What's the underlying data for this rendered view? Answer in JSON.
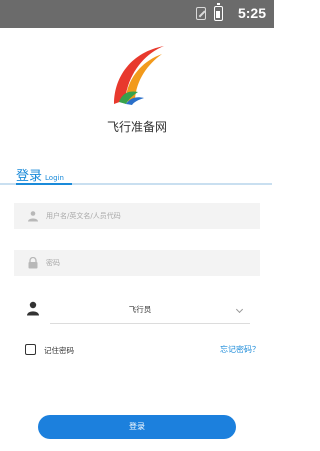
{
  "status_bar": {
    "time": "5:25"
  },
  "app": {
    "name": "飞行准备网"
  },
  "tab": {
    "label": "登录",
    "label_en": "Login"
  },
  "form": {
    "username_placeholder": "用户名/英文名/人员代码",
    "password_placeholder": "密码",
    "role_value": "飞行员",
    "remember_label": "记住密码",
    "forgot_label": "忘记密码？",
    "submit_label": "登录"
  },
  "colors": {
    "accent": "#1a8ad9",
    "button": "#1c80dd",
    "status_bar": "#6b6b6b"
  },
  "icons": [
    "sim-icon",
    "battery-icon",
    "logo-icon",
    "user-icon",
    "lock-icon",
    "role-person-icon",
    "chevron-down-icon"
  ]
}
